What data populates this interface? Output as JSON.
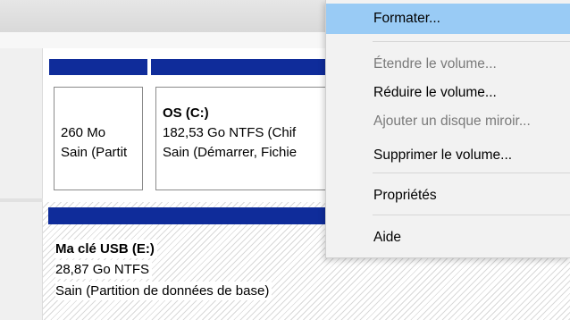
{
  "partitions": {
    "recovery": {
      "size": "260 Mo",
      "status": "Sain (Partit"
    },
    "os": {
      "name": "OS  (C:)",
      "size": "182,53 Go NTFS (Chif",
      "status": "Sain (Démarrer, Fichie"
    },
    "usb": {
      "name": "Ma clé USB  (E:)",
      "size": "28,87 Go NTFS",
      "status": "Sain (Partition de données de base)"
    }
  },
  "context_menu": {
    "items": [
      {
        "label": "Formater...",
        "state": "highlighted"
      },
      {
        "label": "Étendre le volume...",
        "state": "disabled"
      },
      {
        "label": "Réduire le volume...",
        "state": "enabled"
      },
      {
        "label": "Ajouter un disque miroir...",
        "state": "disabled"
      },
      {
        "label": "Supprimer le volume...",
        "state": "enabled"
      },
      {
        "label": "Propriétés",
        "state": "enabled"
      },
      {
        "label": "Aide",
        "state": "enabled"
      }
    ]
  },
  "colors": {
    "volume_header": "#0f2c9a",
    "menu_highlight": "#99cbf5",
    "menu_background": "#f2f2f2",
    "disabled_text": "#7a7a7a"
  }
}
